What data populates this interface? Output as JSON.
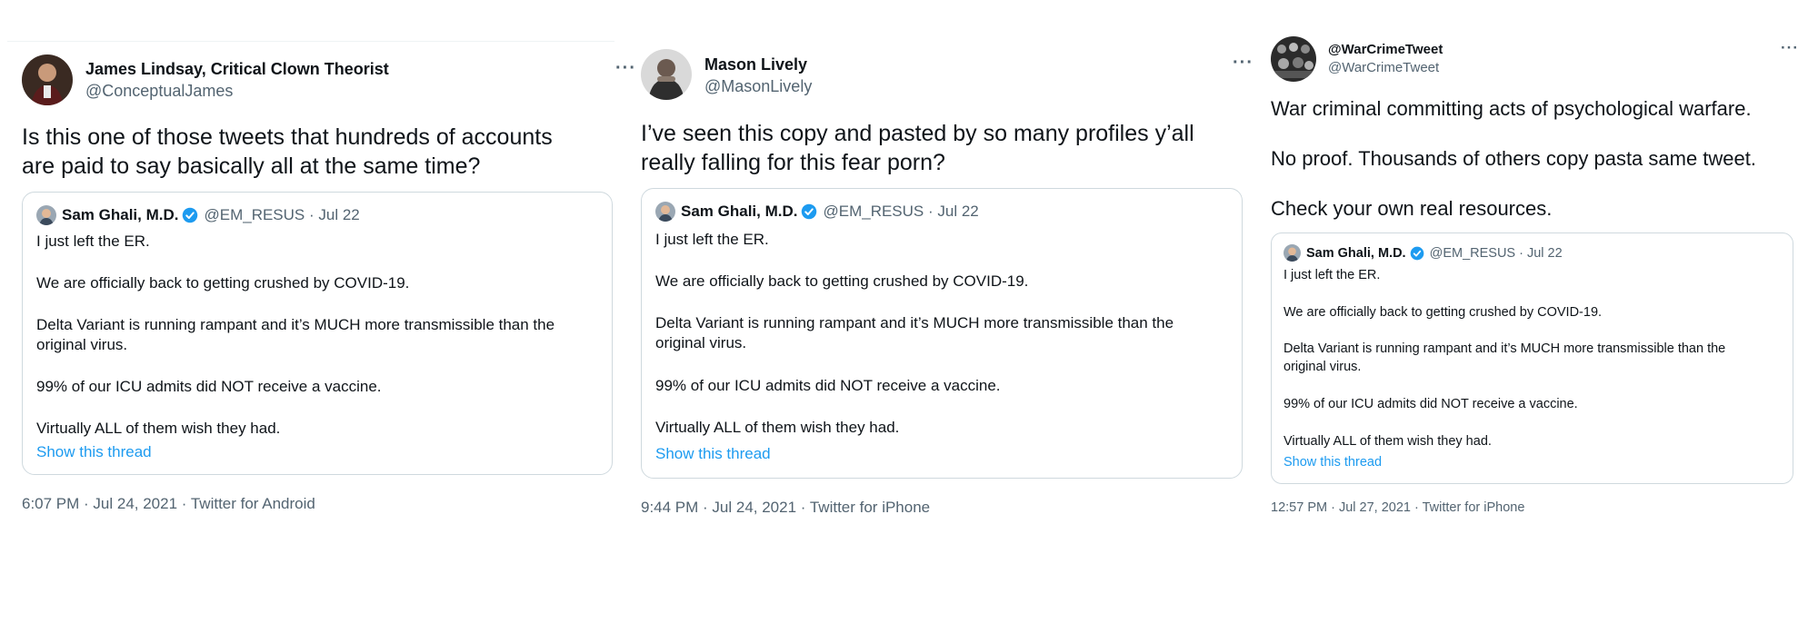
{
  "tweets": [
    {
      "author": {
        "name": "James Lindsay, Critical Clown Theorist",
        "handle": "@ConceptualJames"
      },
      "more_icon": "ellipsis-icon",
      "text_lines": [
        "Is this one of those tweets that hundreds of accounts",
        "are paid to say basically all at the same time?"
      ],
      "timestamp": "6:07 PM · Jul 24, 2021 · Twitter for Android"
    },
    {
      "author": {
        "name": "Mason Lively",
        "handle": "@MasonLively"
      },
      "more_icon": "ellipsis-icon",
      "text_lines": [
        "I’ve seen this copy and pasted by so many profiles y’all",
        "really falling for this fear porn?"
      ],
      "timestamp": "9:44 PM · Jul 24, 2021 · Twitter for iPhone"
    },
    {
      "author": {
        "name": "@WarCrimeTweet",
        "handle": "@WarCrimeTweet"
      },
      "more_icon": "ellipsis-icon",
      "text_paragraphs": [
        "War criminal committing acts of psychological warfare.",
        "No proof. Thousands of others copy pasta same tweet.",
        "Check your own real resources."
      ],
      "timestamp": "12:57 PM · Jul 27, 2021 · Twitter for iPhone"
    }
  ],
  "quoted": {
    "name": "Sam Ghali, M.D.",
    "verified_icon": "verified-badge-icon",
    "handle_date": "@EM_RESUS · Jul 22",
    "lines": [
      "I just left the ER.",
      "We are officially back to getting crushed by COVID-19.",
      "Delta Variant is running rampant and it’s MUCH more transmissible than the",
      "original virus.",
      "99% of our ICU admits did NOT receive a vaccine.",
      "Virtually ALL of them wish they had."
    ],
    "show_thread": "Show this thread"
  },
  "colors": {
    "link": "#1d9bf0",
    "muted": "#536471",
    "border": "#cfd9de",
    "verified": "#1d9bf0"
  }
}
